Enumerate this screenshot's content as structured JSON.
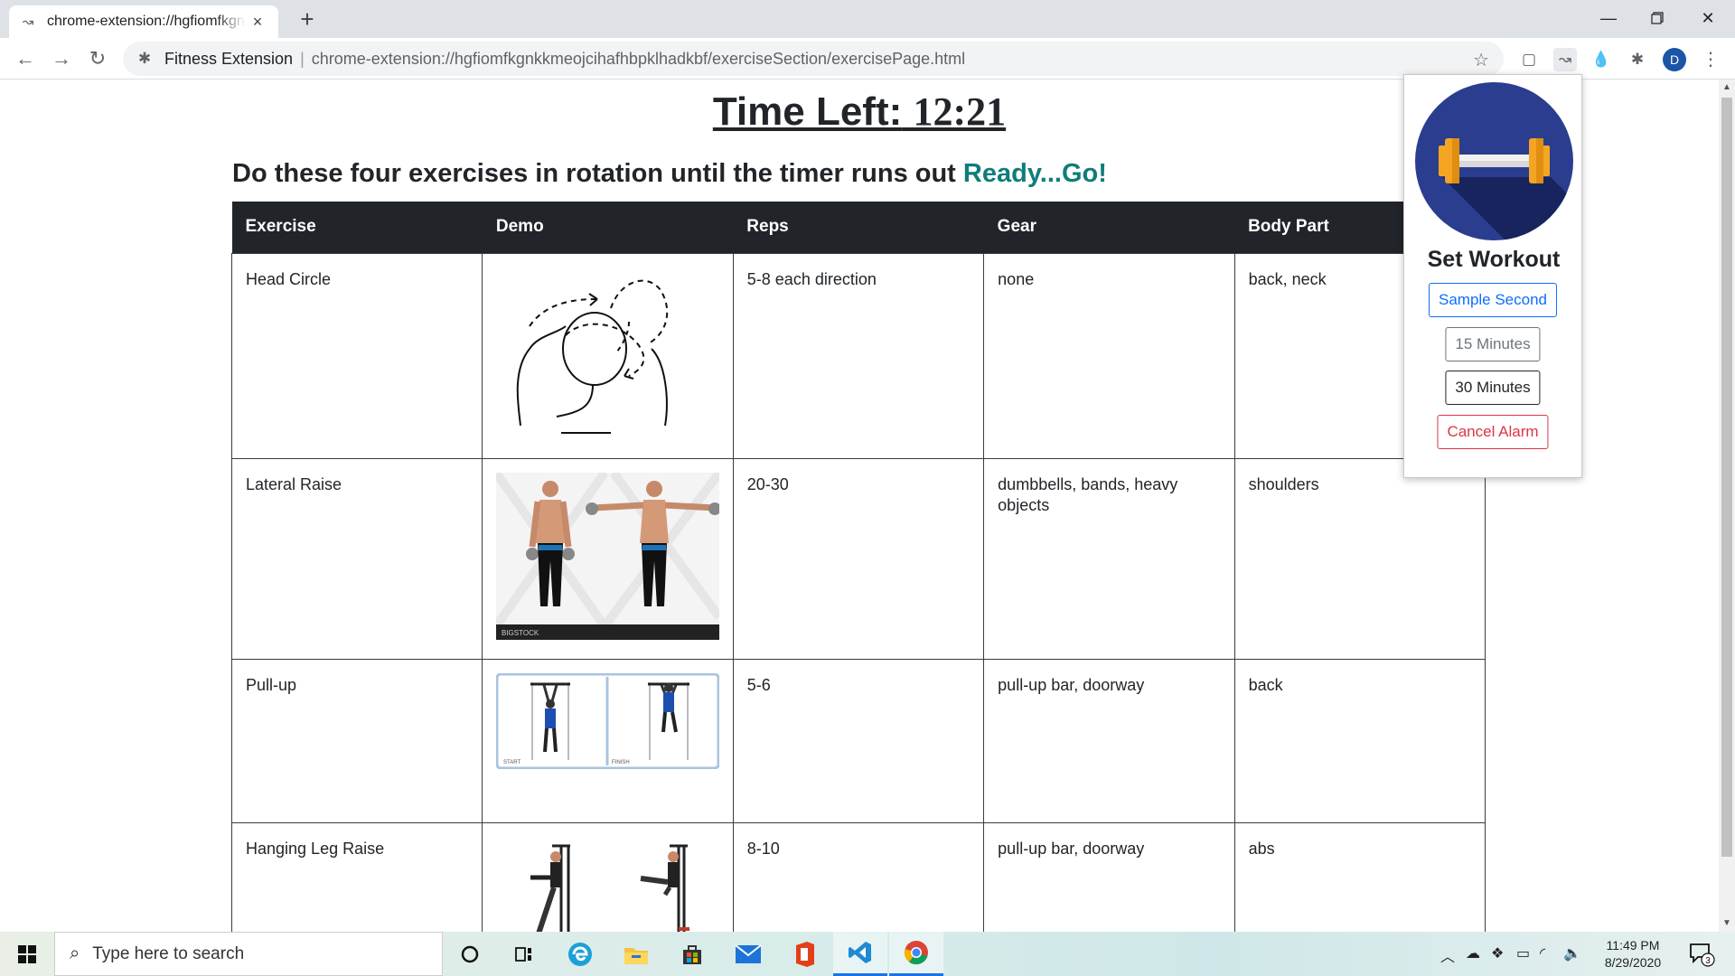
{
  "browser": {
    "tab_title": "chrome-extension://hgfiomfkgnkkmeojcihafhbpklhadkbf/exerciseSection/exercisePage.html",
    "site_name": "Fitness Extension",
    "url": "chrome-extension://hgfiomfkgnkkmeojcihafhbpklhadkbf/exerciseSection/exercisePage.html",
    "avatar_letter": "D"
  },
  "page": {
    "timer_label": "Time Left:",
    "timer_value": "12:21",
    "instructions": "Do these four exercises in rotation until the timer runs out",
    "ready_text": "Ready...Go!",
    "columns": [
      "Exercise",
      "Demo",
      "Reps",
      "Gear",
      "Body Part"
    ],
    "rows": [
      {
        "exercise": "Head Circle",
        "reps": "5-8 each direction",
        "gear": "none",
        "body_part": "back, neck",
        "demo_icon": "head-circle-demo"
      },
      {
        "exercise": "Lateral Raise",
        "reps": "20-30",
        "gear": "dumbbells, bands, heavy objects",
        "body_part": "shoulders",
        "demo_icon": "lateral-raise-demo",
        "demo_caption": "BIGSTOCK"
      },
      {
        "exercise": "Pull-up",
        "reps": "5-6",
        "gear": "pull-up bar, doorway",
        "body_part": "back",
        "demo_icon": "pull-up-demo",
        "demo_captions": [
          "START",
          "FINISH"
        ]
      },
      {
        "exercise": "Hanging Leg Raise",
        "reps": "8-10",
        "gear": "pull-up bar, doorway",
        "body_part": "abs",
        "demo_icon": "hanging-leg-raise-demo"
      }
    ]
  },
  "popup": {
    "title": "Set Workout",
    "buttons": {
      "sample": "Sample Second",
      "fifteen": "15 Minutes",
      "thirty": "30 Minutes",
      "cancel": "Cancel Alarm"
    },
    "colors": {
      "logo_bg": "#2b3d8f",
      "dumbbell": "#f4a623"
    }
  },
  "taskbar": {
    "search_placeholder": "Type here to search",
    "time": "11:49 PM",
    "date": "8/29/2020",
    "notification_count": "3"
  },
  "colors": {
    "accent": "#0e7d7b",
    "table_header": "#212529"
  }
}
